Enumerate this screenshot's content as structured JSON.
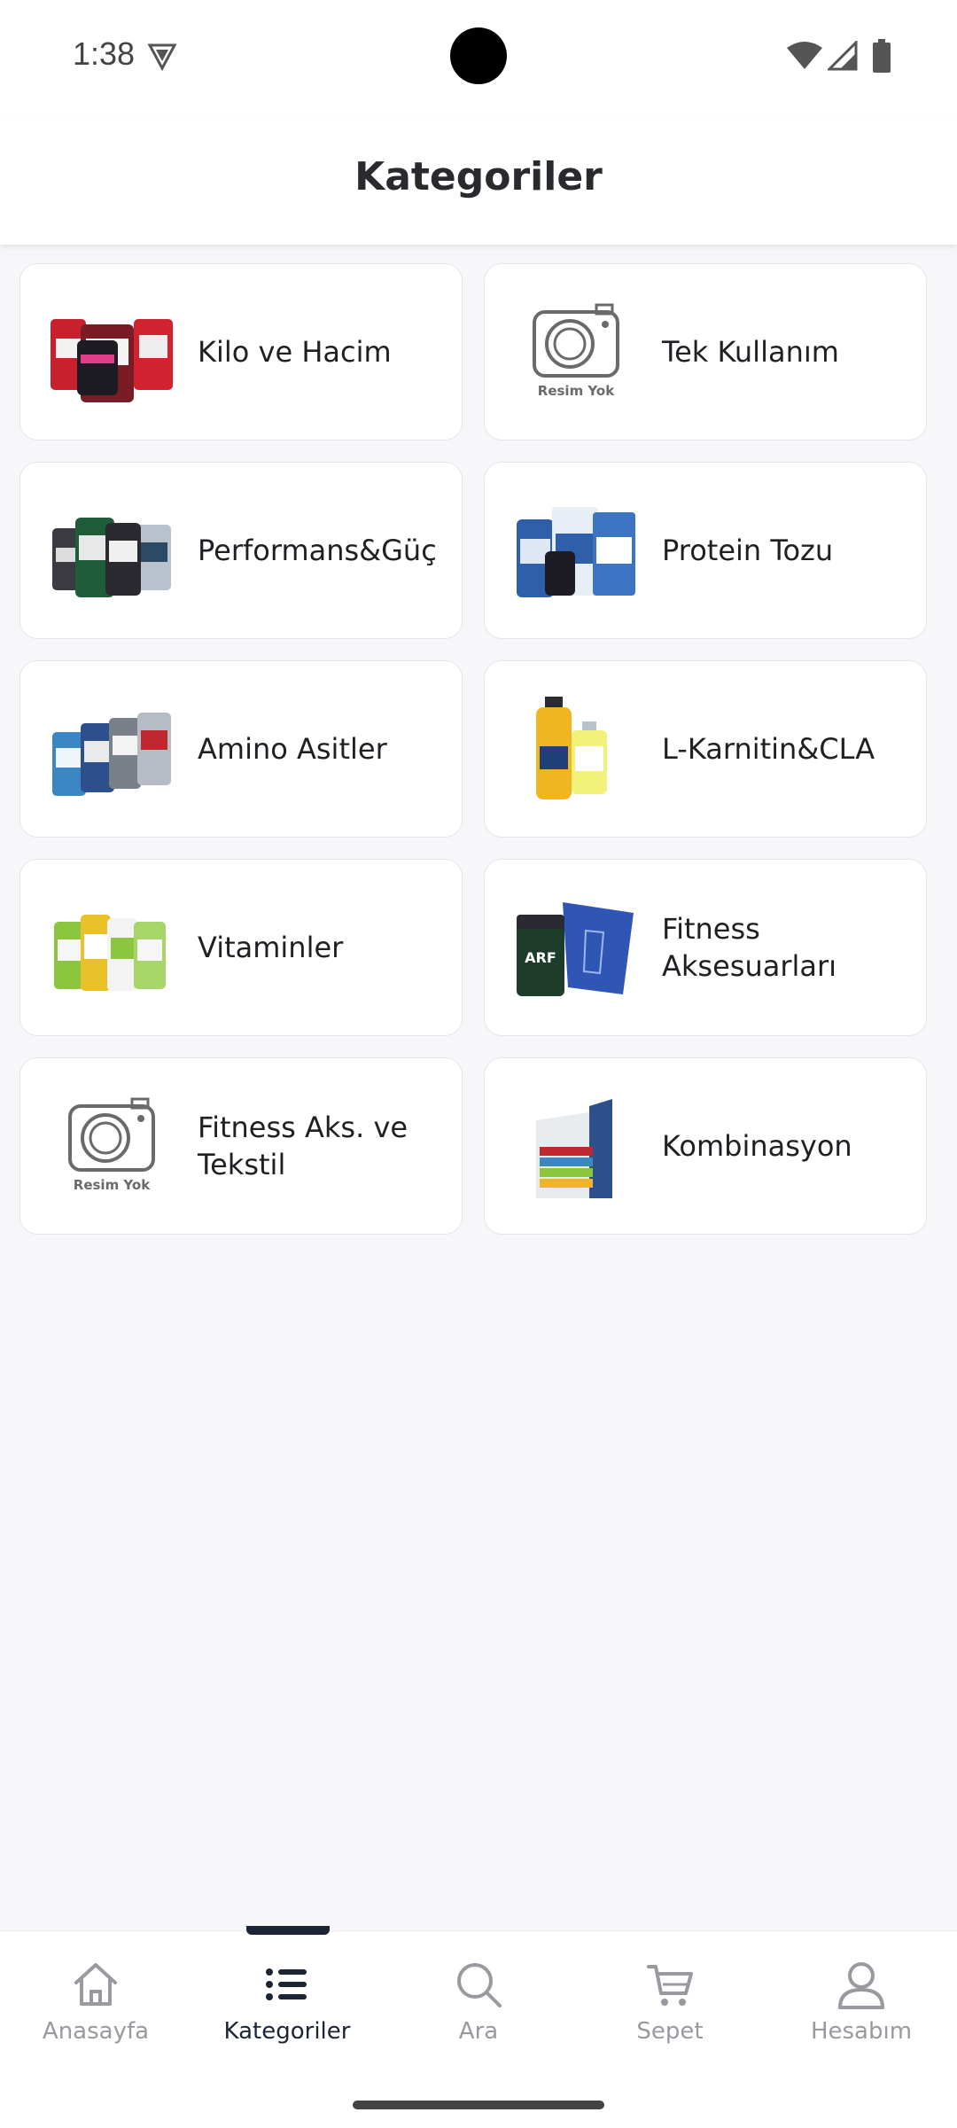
{
  "status_bar": {
    "time": "1:38"
  },
  "header": {
    "title": "Kategoriler"
  },
  "categories": [
    {
      "label": "Kilo ve Hacim",
      "thumb": "product-jars-red"
    },
    {
      "label": "Tek Kullanım",
      "thumb": "no-image-camera",
      "thumb_caption": "Resim Yok"
    },
    {
      "label": "Performans&Güç",
      "thumb": "product-jars-dark"
    },
    {
      "label": "Protein Tozu",
      "thumb": "product-boxes-blue"
    },
    {
      "label": "Amino Asitler",
      "thumb": "product-jars-blue"
    },
    {
      "label": "L-Karnitin&CLA",
      "thumb": "product-bottles-yellow"
    },
    {
      "label": "Vitaminler",
      "thumb": "product-jars-green"
    },
    {
      "label": "Fitness Aksesuarları",
      "thumb": "shaker-and-bag"
    },
    {
      "label": "Fitness Aks. ve Tekstil",
      "thumb": "no-image-camera",
      "thumb_caption": "Resim Yok"
    },
    {
      "label": "Kombinasyon",
      "thumb": "display-stand"
    }
  ],
  "bottom_nav": [
    {
      "label": "Anasayfa",
      "icon": "home-icon",
      "active": false
    },
    {
      "label": "Kategoriler",
      "icon": "list-icon",
      "active": true
    },
    {
      "label": "Ara",
      "icon": "search-icon",
      "active": false
    },
    {
      "label": "Sepet",
      "icon": "cart-icon",
      "active": false
    },
    {
      "label": "Hesabım",
      "icon": "user-icon",
      "active": false
    }
  ],
  "colors": {
    "accent": "#1c2533",
    "inactive": "#9a99a0",
    "background": "#f7f6f9"
  }
}
